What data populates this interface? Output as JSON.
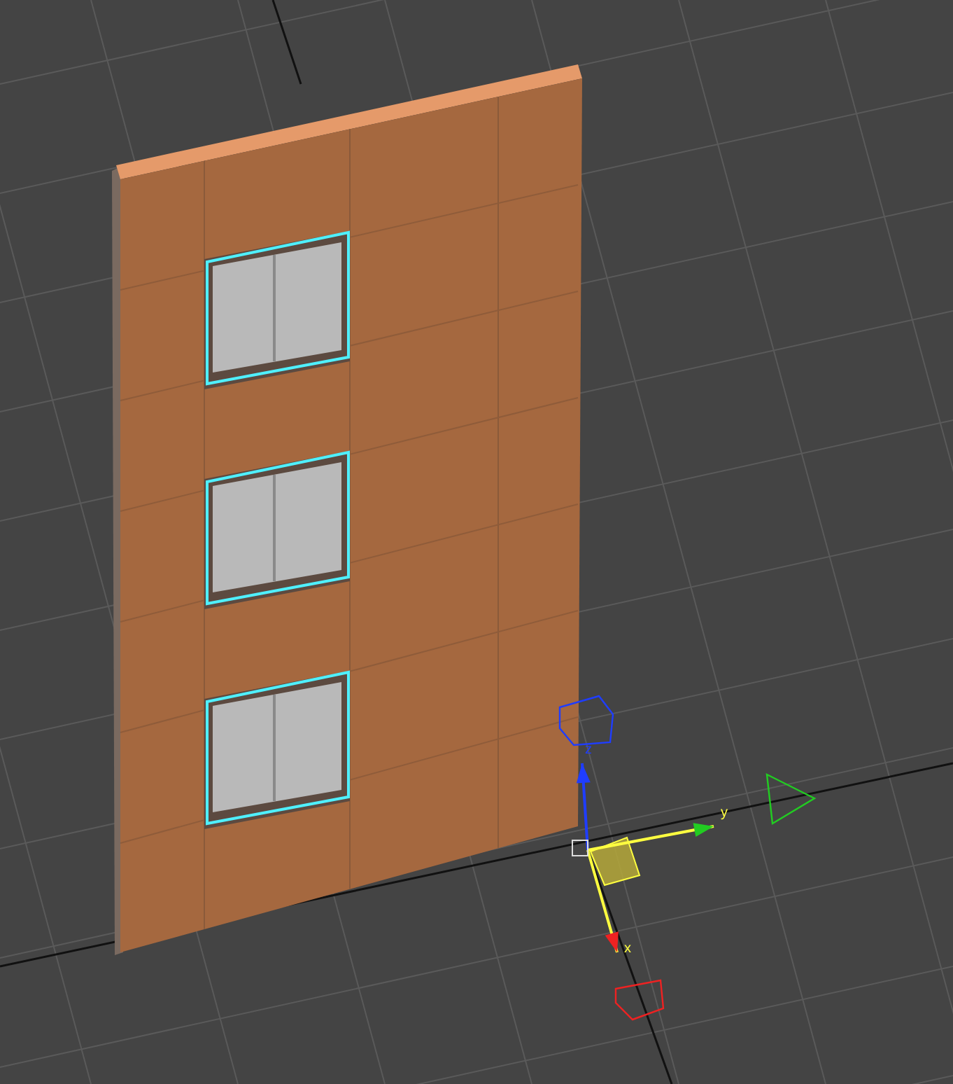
{
  "wall": {
    "windows": [
      {
        "selected": true
      },
      {
        "selected": true
      },
      {
        "selected": true
      }
    ]
  },
  "gizmo": {
    "axes": [
      {
        "label": "z",
        "color": "#1f3dff",
        "selected": false
      },
      {
        "label": "y",
        "color": "#22cc22",
        "selected": true
      },
      {
        "label": "x",
        "color": "#ee2222",
        "selected": true
      }
    ]
  }
}
